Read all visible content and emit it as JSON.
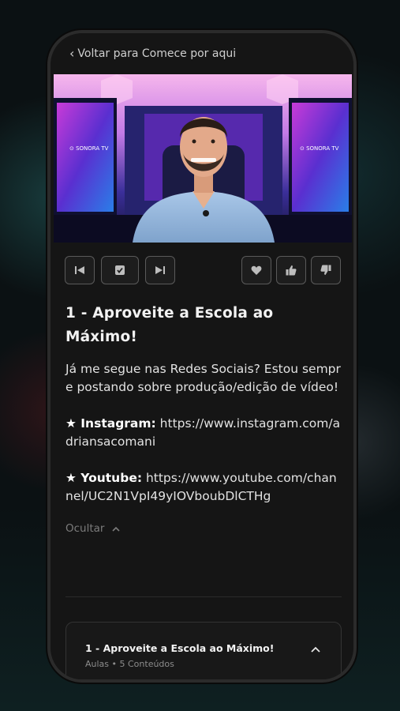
{
  "nav": {
    "back_label": "Voltar para Comece por aqui"
  },
  "video": {
    "screen_brand": "⊙ SONORA TV"
  },
  "controls": {
    "previous_icon": "skip-previous-icon",
    "complete_icon": "check-square-icon",
    "next_icon": "skip-next-icon",
    "favorite_icon": "heart-icon",
    "like_icon": "thumbs-up-icon",
    "dislike_icon": "thumbs-down-icon"
  },
  "lesson": {
    "title": "1 - Aproveite a Escola ao Máximo!",
    "intro": "Já me segue nas Redes Sociais? Estou sempre postando sobre produção/edição de vídeo!",
    "instagram_label": "★ Instagram:",
    "instagram_url": " https://www.instagram.com/adriansacomani",
    "youtube_label": "★ Youtube:",
    "youtube_url": " https://www.youtube.com/channel/UC2N1VpI49yIOVboubDlCTHg",
    "hide_label": "Ocultar"
  },
  "module": {
    "title": "1 - Aproveite a Escola ao Máximo!",
    "subtitle": "Aulas • 5 Conteúdos"
  },
  "colors": {
    "background": "#0b1113",
    "panel": "#151515",
    "border": "#5a5a5a",
    "text": "#f2f2f2",
    "muted": "#7c7c7c"
  }
}
